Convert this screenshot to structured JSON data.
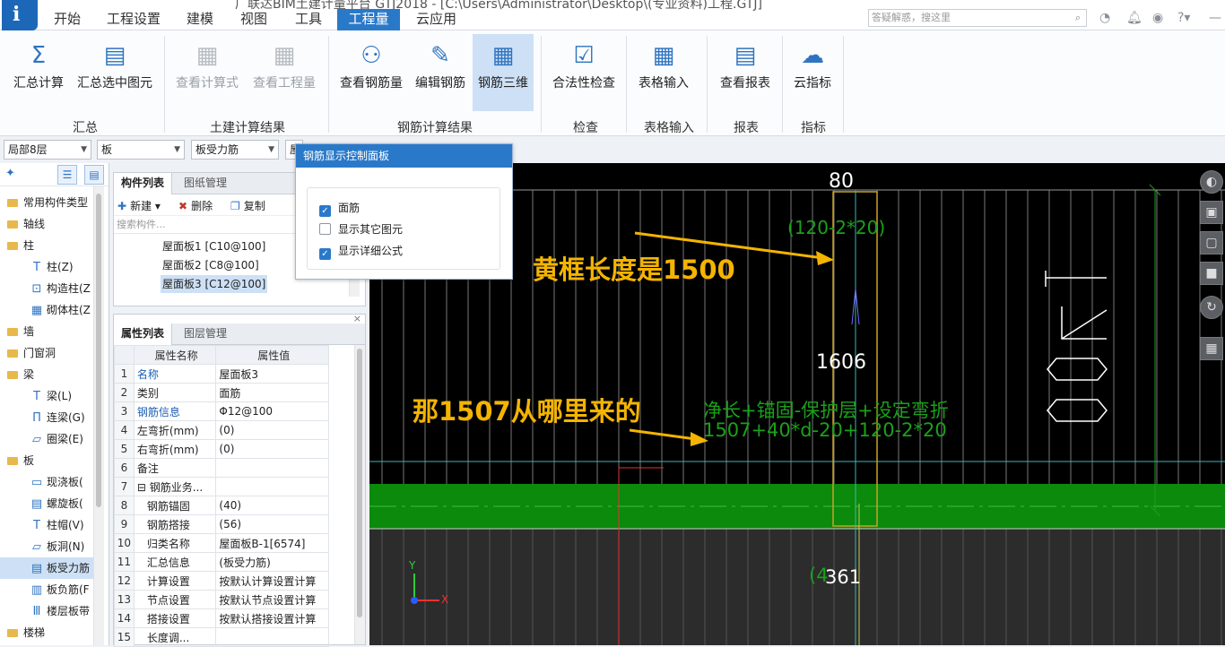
{
  "titlebar": {
    "app_icon_glyph": "i",
    "title": "广联达BIM土建计量平台 GTJ2018 - [C:\\Users\\Administrator\\Desktop\\(专业资料)工程.GTJ]",
    "search_placeholder": "答疑解惑，搜这里",
    "tabs": [
      "开始",
      "工程设置",
      "建模",
      "视图",
      "工具",
      "工程量",
      "云应用"
    ],
    "active_tab": "工程量"
  },
  "ribbon": {
    "buttons": [
      {
        "label": "汇总计算",
        "icon": "sigma-icon"
      },
      {
        "label": "汇总选中图元",
        "icon": "table-calc-icon"
      },
      {
        "label": "查看计算式",
        "icon": "view-formula-icon",
        "disabled": true
      },
      {
        "label": "查看工程量",
        "icon": "view-quantity-icon",
        "disabled": true
      },
      {
        "label": "查看钢筋量",
        "icon": "glasses-icon"
      },
      {
        "label": "编辑钢筋",
        "icon": "pencil-icon"
      },
      {
        "label": "钢筋三维",
        "icon": "rebar-3d-icon",
        "active": true
      },
      {
        "label": "合法性检查",
        "icon": "check-icon"
      },
      {
        "label": "表格输入",
        "icon": "grid-input-icon"
      },
      {
        "label": "查看报表",
        "icon": "report-icon"
      },
      {
        "label": "云指标",
        "icon": "cloud-icon"
      }
    ],
    "groups": [
      "汇总",
      "土建计算结果",
      "钢筋计算结果",
      "检查",
      "表格输入",
      "报表",
      "指标"
    ]
  },
  "selectors": [
    "局部8层",
    "板",
    "板受力筋",
    "屋"
  ],
  "tree": {
    "items": [
      {
        "label": "常用构件类型",
        "level": 0
      },
      {
        "label": "轴线",
        "level": 0
      },
      {
        "label": "柱",
        "level": 0
      },
      {
        "label": "柱(Z)",
        "level": 1,
        "icon": "T"
      },
      {
        "label": "构造柱(Z",
        "level": 1,
        "icon": "⊡"
      },
      {
        "label": "砌体柱(Z",
        "level": 1,
        "icon": "▦"
      },
      {
        "label": "墙",
        "level": 0
      },
      {
        "label": "门窗洞",
        "level": 0
      },
      {
        "label": "梁",
        "level": 0
      },
      {
        "label": "梁(L)",
        "level": 1,
        "icon": "T"
      },
      {
        "label": "连梁(G)",
        "level": 1,
        "icon": "П"
      },
      {
        "label": "圈梁(E)",
        "level": 1,
        "icon": "▱"
      },
      {
        "label": "板",
        "level": 0
      },
      {
        "label": "现浇板(",
        "level": 1,
        "icon": "▭"
      },
      {
        "label": "螺旋板(",
        "level": 1,
        "icon": "▤"
      },
      {
        "label": "柱帽(V)",
        "level": 1,
        "icon": "T"
      },
      {
        "label": "板洞(N)",
        "level": 1,
        "icon": "▱"
      },
      {
        "label": "板受力筋",
        "level": 1,
        "icon": "▤",
        "selected": true
      },
      {
        "label": "板负筋(F",
        "level": 1,
        "icon": "▥"
      },
      {
        "label": "楼层板带",
        "level": 1,
        "icon": "Ⅲ"
      },
      {
        "label": "楼梯",
        "level": 0
      }
    ]
  },
  "component_list": {
    "tabs": [
      "构件列表",
      "图纸管理"
    ],
    "new": "新建",
    "delete": "删除",
    "copy": "复制",
    "search_placeholder": "搜索构件...",
    "items": [
      "屋面板1 [C10@100]",
      "屋面板2 [C8@100]",
      "屋面板3 [C12@100]"
    ],
    "selected": 2
  },
  "properties": {
    "tabs": [
      "属性列表",
      "图层管理"
    ],
    "headers": [
      "属性名称",
      "属性值"
    ],
    "rows": [
      {
        "n": "1",
        "k": "名称",
        "v": "屋面板3",
        "blue": true
      },
      {
        "n": "2",
        "k": "类别",
        "v": "面筋"
      },
      {
        "n": "3",
        "k": "钢筋信息",
        "v": "Φ12@100",
        "blue": true
      },
      {
        "n": "4",
        "k": "左弯折(mm)",
        "v": "(0)"
      },
      {
        "n": "5",
        "k": "右弯折(mm)",
        "v": "(0)"
      },
      {
        "n": "6",
        "k": "备注",
        "v": ""
      },
      {
        "n": "7",
        "k": "⊟ 钢筋业务...",
        "v": ""
      },
      {
        "n": "8",
        "k": "钢筋锚固",
        "v": "(40)",
        "indent": true
      },
      {
        "n": "9",
        "k": "钢筋搭接",
        "v": "(56)",
        "indent": true
      },
      {
        "n": "10",
        "k": "归类名称",
        "v": "屋面板B-1[6574]",
        "indent": true
      },
      {
        "n": "11",
        "k": "汇总信息",
        "v": "(板受力筋)",
        "indent": true
      },
      {
        "n": "12",
        "k": "计算设置",
        "v": "按默认计算设置计算",
        "indent": true
      },
      {
        "n": "13",
        "k": "节点设置",
        "v": "按默认节点设置计算",
        "indent": true
      },
      {
        "n": "14",
        "k": "搭接设置",
        "v": "按默认搭接设置计算",
        "indent": true
      },
      {
        "n": "15",
        "k": "长度调...",
        "v": "",
        "indent": true
      }
    ]
  },
  "rebar_panel": {
    "title": "钢筋显示控制面板",
    "options": [
      {
        "label": "面筋",
        "checked": true
      },
      {
        "label": "显示其它图元",
        "checked": false
      },
      {
        "label": "显示详细公式",
        "checked": true
      }
    ]
  },
  "canvas": {
    "dim_top": "80",
    "formula_top": "(120-2*20)",
    "length_label": "1606",
    "annotation_1": "黄框长度是1500",
    "annotation_2": "那1507从哪里来的",
    "formula_line1": "净长+锚固-保护层+设定弯折",
    "formula_line2": "1507+40*d-20+120-2*20",
    "vertical_text": "1400",
    "bottom_label": "361",
    "bottom_paren": "(4",
    "axis_y": "Y",
    "axis_x": "X",
    "colors": {
      "green": "#1aa11a",
      "yellow": "#c9a227",
      "annotation": "#f4b400",
      "cyan": "#39b8b8"
    }
  }
}
